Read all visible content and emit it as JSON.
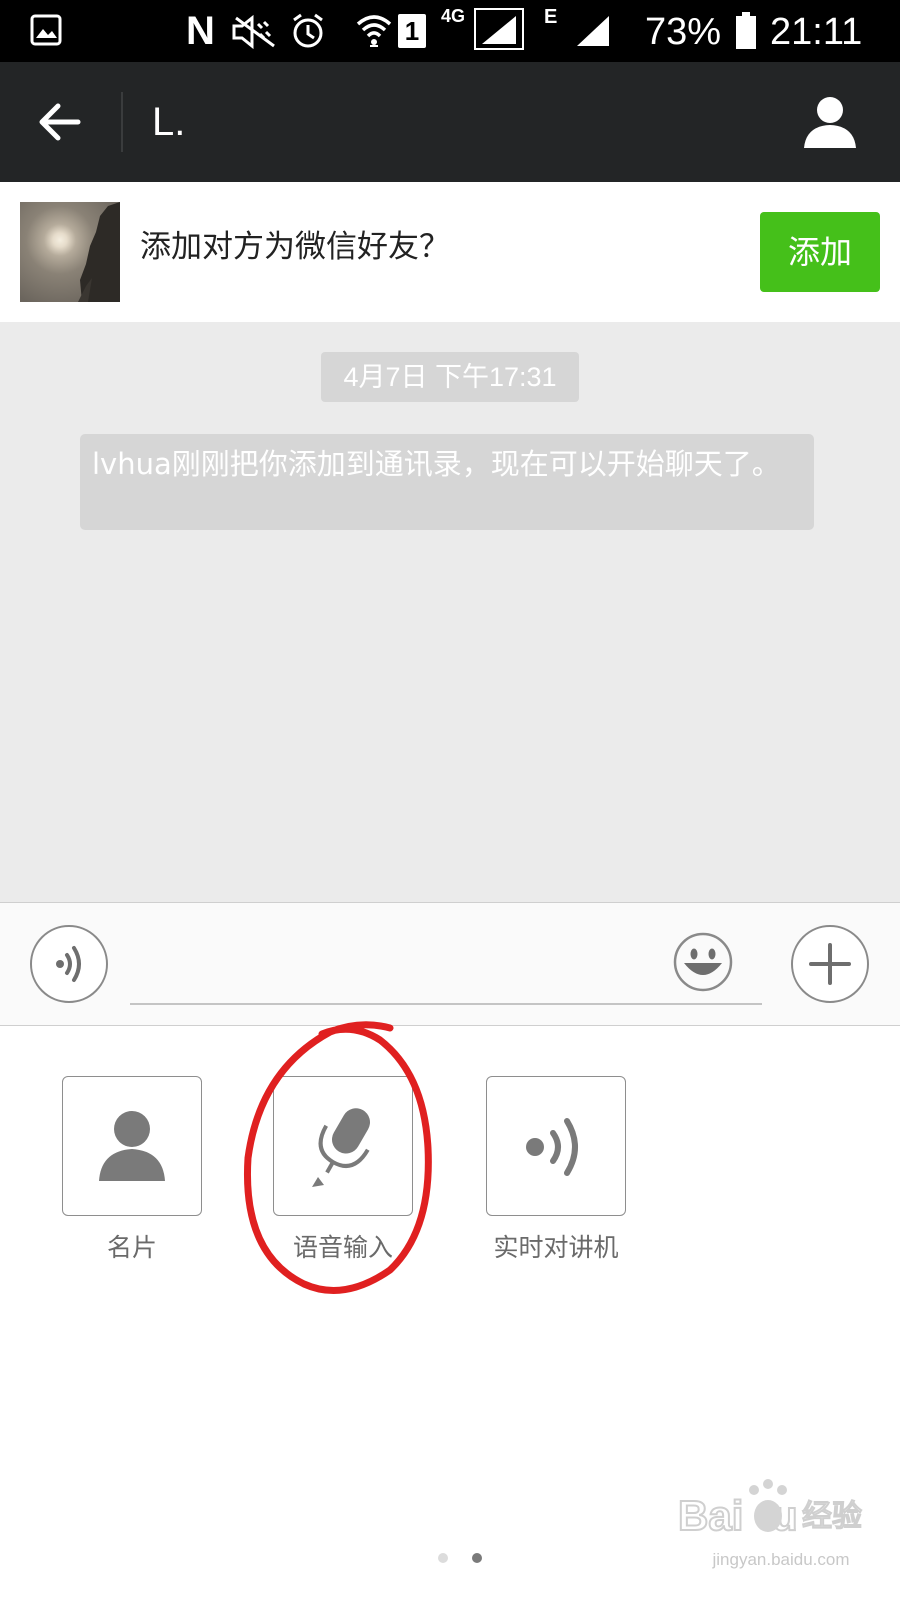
{
  "status_bar": {
    "battery": "73%",
    "time": "21:11",
    "network_type": "4G",
    "secondary_network": "E",
    "sim_slot": "1",
    "notification_letter": "N",
    "icons": [
      "gallery-icon",
      "nfc-icon",
      "mute-icon",
      "alarm-icon",
      "wifi-icon",
      "sim-1-icon",
      "signal-4g-icon",
      "signal-e-icon",
      "battery-icon"
    ]
  },
  "header": {
    "back_icon": "arrow-left-icon",
    "title": "L.",
    "profile_icon": "person-icon"
  },
  "add_friend": {
    "prompt": "添加对方为微信好友？",
    "button_label": "添加",
    "button_color": "#45c01a"
  },
  "chat": {
    "timestamp": "4月7日 下午17:31",
    "system_message": "lvhua刚刚把你添加到通讯录，现在可以开始聊天了。"
  },
  "input_bar": {
    "voice_icon": "voice-wave-icon",
    "emoji_icon": "smiley-icon",
    "more_icon": "plus-icon"
  },
  "more_panel": {
    "items": [
      {
        "label": "名片",
        "icon": "contact-card-icon"
      },
      {
        "label": "语音输入",
        "icon": "microphone-icon",
        "highlighted": true
      },
      {
        "label": "实时对讲机",
        "icon": "walkie-talkie-icon"
      }
    ],
    "page_count": 2,
    "current_page": 2
  },
  "annotation": {
    "color": "#e02020",
    "target": "语音输入"
  },
  "watermark": {
    "logo": "Baidu经验",
    "domain": "jingyan.baidu.com"
  },
  "colors": {
    "nav_background": "#232526",
    "chat_background": "#ebebeb",
    "system_bubble": "#d6d6d6"
  }
}
